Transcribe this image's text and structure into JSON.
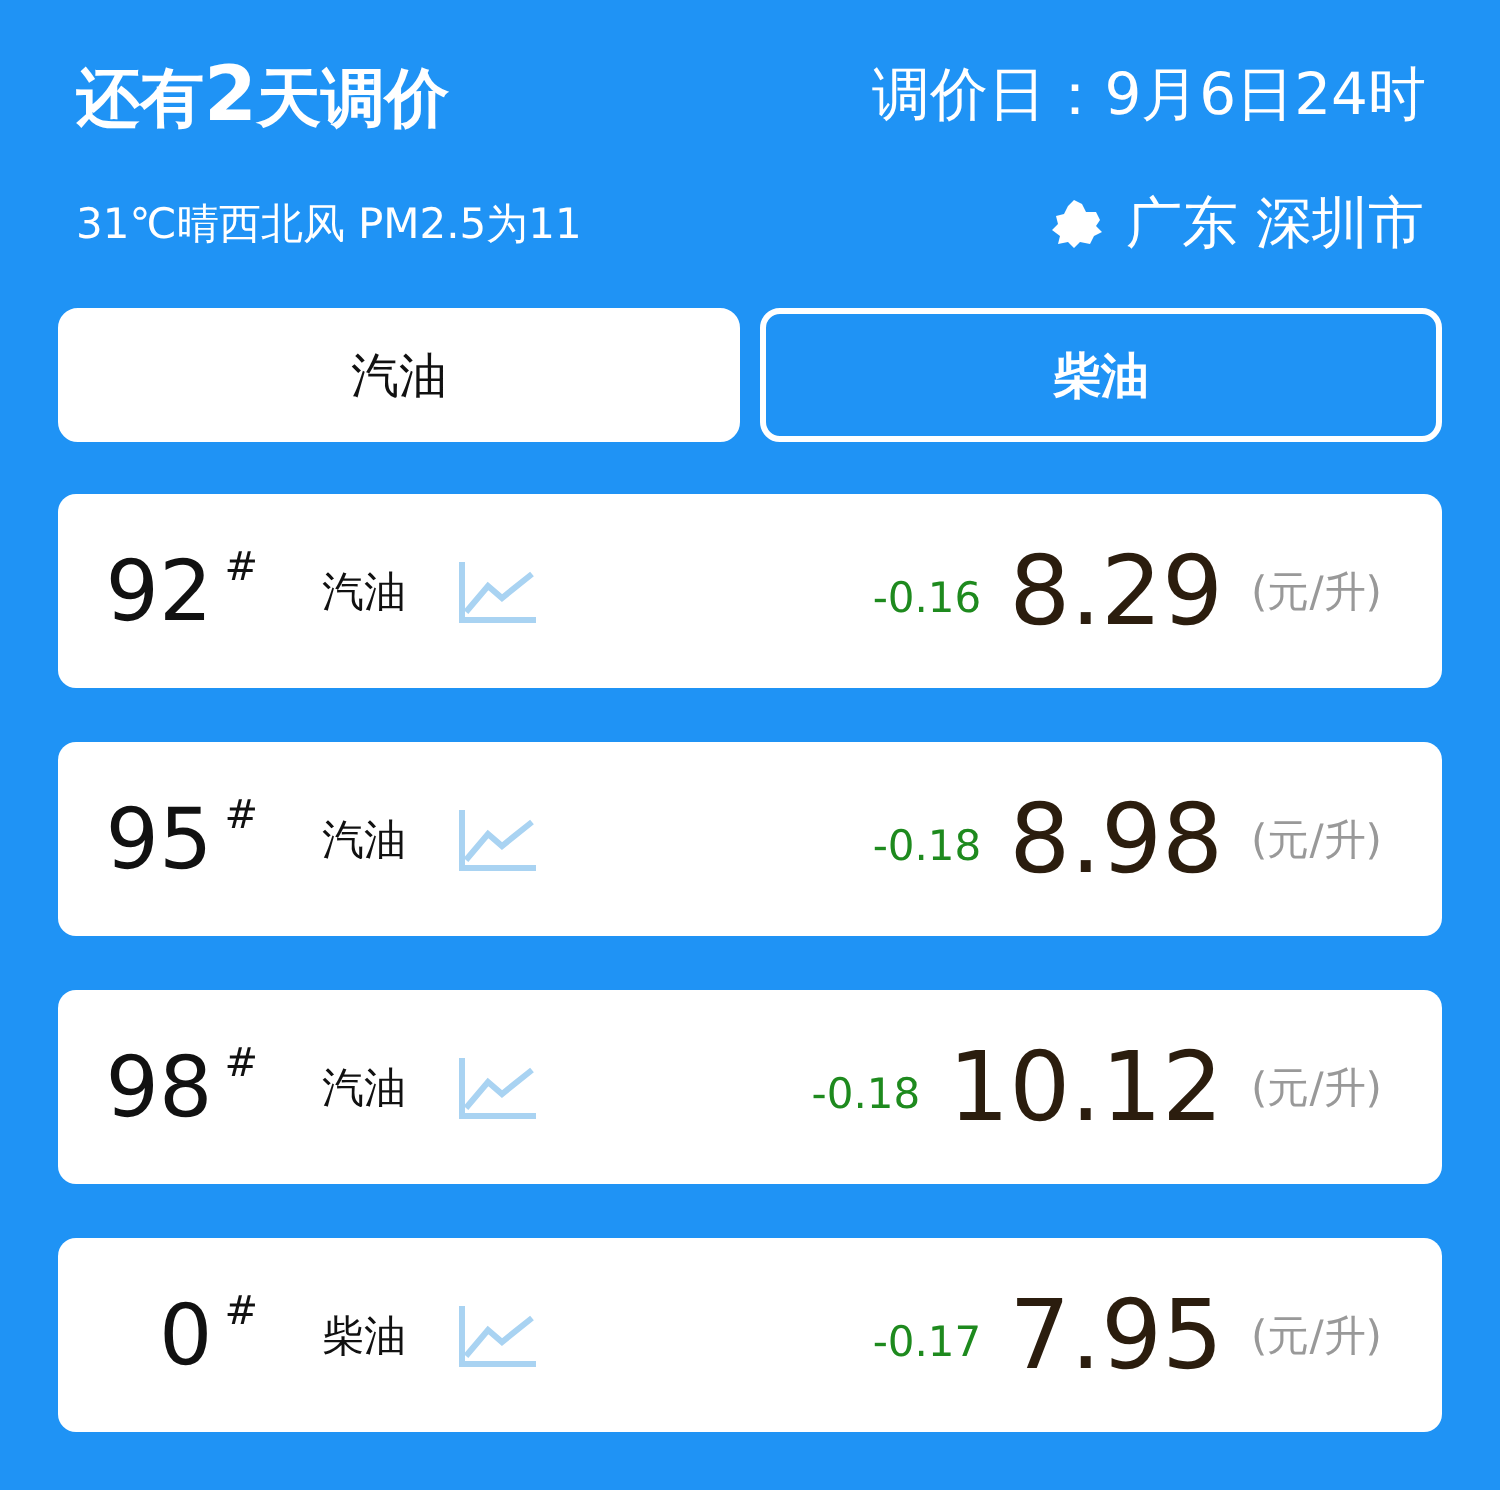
{
  "header": {
    "countdown": "还有**2**天调价",
    "adjust_date": "调价日：9月6日24时",
    "weather": "31℃晴西北风 PM2.5为11",
    "location": "广东 深圳市"
  },
  "tabs": [
    {
      "label": "汽油",
      "selected": false
    },
    {
      "label": "柴油",
      "selected": true
    }
  ],
  "prices": [
    {
      "grade": "92",
      "grade_mark": "#",
      "type": "汽油",
      "change": "-0.16",
      "price": "8.29",
      "unit": "(元/升)"
    },
    {
      "grade": "95",
      "grade_mark": "#",
      "type": "汽油",
      "change": "-0.18",
      "price": "8.98",
      "unit": "(元/升)"
    },
    {
      "grade": "98",
      "grade_mark": "#",
      "type": "汽油",
      "change": "-0.18",
      "price": "10.12",
      "unit": "(元/升)"
    },
    {
      "grade": "0",
      "grade_mark": "#",
      "type": "柴油",
      "change": "-0.17",
      "price": "7.95",
      "unit": "(元/升)"
    }
  ]
}
